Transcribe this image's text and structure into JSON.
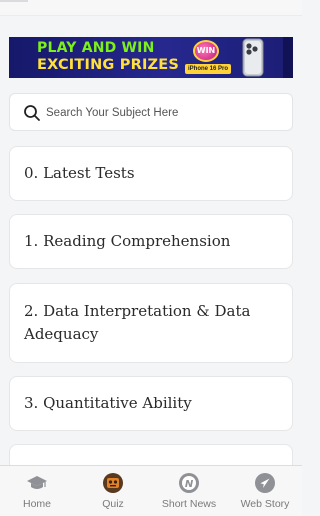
{
  "banner": {
    "line1": "PLAY AND WIN",
    "line2": "EXCITING PRIZES",
    "badge": "WIN",
    "phone_tag": "iPhone 16 Pro"
  },
  "search": {
    "placeholder": "Search Your Subject Here",
    "icon": "search-icon"
  },
  "subjects": [
    {
      "label": "0. Latest Tests"
    },
    {
      "label": "1. Reading Comprehension"
    },
    {
      "label": "2. Data Interpretation & Data Adequacy"
    },
    {
      "label": "3. Quantitative Ability"
    }
  ],
  "bottom_nav": {
    "items": [
      {
        "label": "Home",
        "icon": "graduation-cap-icon"
      },
      {
        "label": "Quiz",
        "icon": "quiz-icon"
      },
      {
        "label": "Short News",
        "icon": "news-icon"
      },
      {
        "label": "Web Story",
        "icon": "web-story-icon"
      }
    ]
  },
  "colors": {
    "banner_bg": "#1e2080",
    "banner_green": "#7df01a",
    "banner_yellow": "#ffe13a",
    "card_bg": "#ffffff",
    "page_bg": "#f4f5f6",
    "nav_label": "#7a7a7a"
  }
}
